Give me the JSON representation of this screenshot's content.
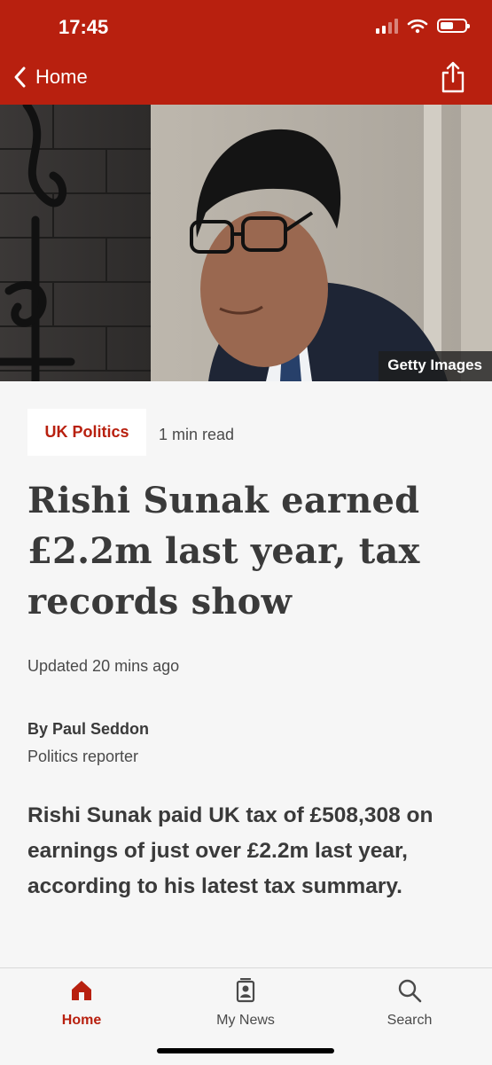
{
  "status_bar": {
    "time": "17:45"
  },
  "nav": {
    "back_label": "Home"
  },
  "hero": {
    "credit": "Getty Images"
  },
  "article": {
    "category": "UK Politics",
    "read_time": "1 min read",
    "headline": "Rishi Sunak earned £2.2m last year, tax records show",
    "updated": "Updated 20 mins ago",
    "author": "By Paul Seddon",
    "author_role": "Politics reporter",
    "lede": "Rishi Sunak paid UK tax of £508,308 on earnings of just over £2.2m last year, according to his latest tax summary."
  },
  "tabs": [
    {
      "label": "Home",
      "icon": "home-icon",
      "active": true
    },
    {
      "label": "My News",
      "icon": "my-news-icon",
      "active": false
    },
    {
      "label": "Search",
      "icon": "search-icon",
      "active": false
    }
  ],
  "colors": {
    "brand_red": "#b8200f",
    "background": "#f6f6f6",
    "text": "#3a3a3a"
  }
}
